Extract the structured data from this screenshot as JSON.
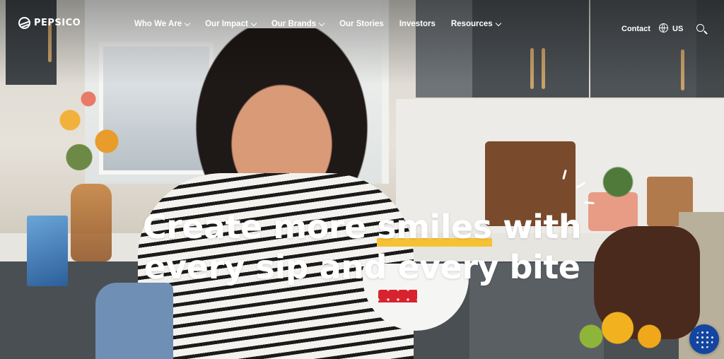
{
  "brand": {
    "name": "PEPSICO"
  },
  "nav": {
    "items": [
      {
        "label": "Who We Are",
        "has_dropdown": true
      },
      {
        "label": "Our Impact",
        "has_dropdown": true
      },
      {
        "label": "Our Brands",
        "has_dropdown": true
      },
      {
        "label": "Our Stories",
        "has_dropdown": false
      },
      {
        "label": "Investors",
        "has_dropdown": false
      },
      {
        "label": "Resources",
        "has_dropdown": true
      }
    ],
    "contact_label": "Contact",
    "region_label": "US",
    "globe_icon": "globe-icon",
    "search_icon": "search-icon"
  },
  "hero": {
    "headline_part1": "Create more ",
    "headline_highlight": "smiles",
    "headline_part2": " with",
    "headline_line2": "every sip and every bite",
    "highlight_color": "#f6c235"
  },
  "chat": {
    "icon": "chat-assistant-icon",
    "color": "#1446a0"
  }
}
